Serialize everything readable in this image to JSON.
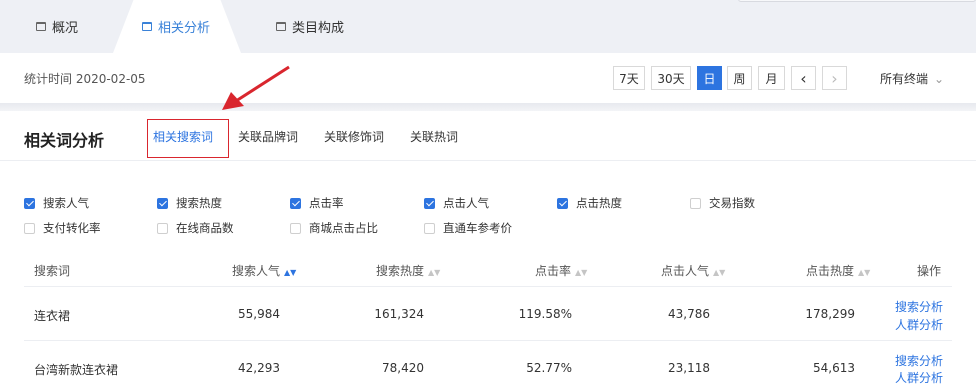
{
  "top_tabs": [
    {
      "label": "概况",
      "active": false
    },
    {
      "label": "相关分析",
      "active": true
    },
    {
      "label": "类目构成",
      "active": false
    }
  ],
  "date_bar": {
    "stat_time": "统计时间 2020-02-05",
    "buttons": [
      "7天",
      "30天",
      "日",
      "周",
      "月"
    ],
    "selected": "日",
    "prev": "‹",
    "next": "›",
    "terminal": "所有终端"
  },
  "section": {
    "title": "相关词分析",
    "tabs": [
      "相关搜索词",
      "关联品牌词",
      "关联修饰词",
      "关联热词"
    ],
    "active_tab": "相关搜索词"
  },
  "metrics": [
    {
      "label": "搜索人气",
      "checked": true
    },
    {
      "label": "搜索热度",
      "checked": true
    },
    {
      "label": "点击率",
      "checked": true
    },
    {
      "label": "点击人气",
      "checked": true
    },
    {
      "label": "点击热度",
      "checked": true
    },
    {
      "label": "交易指数",
      "checked": false
    },
    {
      "label": "支付转化率",
      "checked": false
    },
    {
      "label": "在线商品数",
      "checked": false
    },
    {
      "label": "商城点击占比",
      "checked": false
    },
    {
      "label": "直通车参考价",
      "checked": false
    }
  ],
  "table": {
    "columns": [
      "搜索词",
      "搜索人气",
      "搜索热度",
      "点击率",
      "点击人气",
      "点击热度",
      "操作"
    ],
    "rows": [
      {
        "keyword": "连衣裙",
        "search_pop": "55,984",
        "search_heat": "161,324",
        "ctr": "119.58%",
        "click_pop": "43,786",
        "click_heat": "178,299",
        "actions": [
          "搜索分析",
          "人群分析"
        ]
      },
      {
        "keyword": "台湾新款连衣裙",
        "search_pop": "42,293",
        "search_heat": "78,420",
        "ctr": "52.77%",
        "click_pop": "23,118",
        "click_heat": "54,613",
        "actions": [
          "搜索分析",
          "人群分析"
        ]
      }
    ]
  },
  "colors": {
    "accent": "#2d74e0",
    "annotation": "#d9262e",
    "tabbar": "#eef0f5"
  }
}
